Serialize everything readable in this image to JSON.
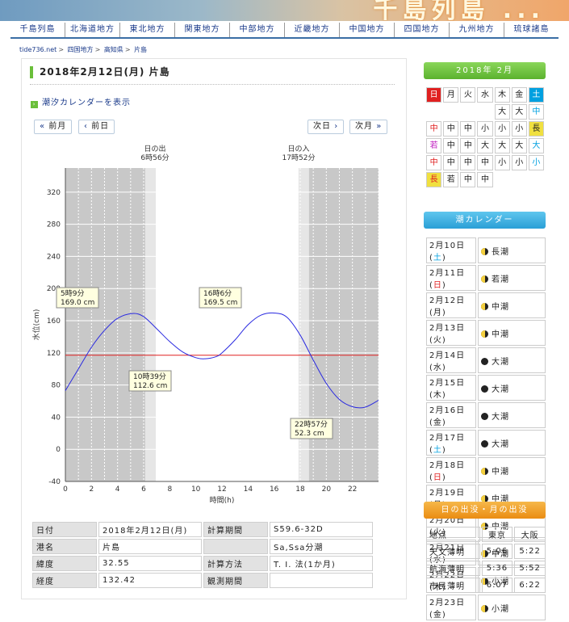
{
  "banner": {
    "title": "千島列島 ..."
  },
  "nav": [
    "千島列島",
    "北海道地方",
    "東北地方",
    "関東地方",
    "中部地方",
    "近畿地方",
    "中国地方",
    "四国地方",
    "九州地方",
    "琉球諸島"
  ],
  "breadcrumb": [
    "tide736.net",
    "四国地方",
    "高知県",
    "片島"
  ],
  "page_title": "2018年2月12日(月) 片島",
  "calendar_link": "潮汐カレンダーを表示",
  "buttons": {
    "prev_month": "前月",
    "prev_day": "前日",
    "next_day": "次日",
    "next_month": "次月"
  },
  "sun": {
    "rise_label": "日の出",
    "rise_time": "6時56分",
    "set_label": "日の入",
    "set_time": "17時52分"
  },
  "chart_data": {
    "type": "line",
    "xlabel": "時間(h)",
    "ylabel": "水位(cm)",
    "xlim": [
      0,
      24
    ],
    "ylim": [
      -40,
      350
    ],
    "xticks": [
      0,
      2,
      4,
      6,
      8,
      10,
      12,
      14,
      16,
      18,
      20,
      22
    ],
    "yticks": [
      -40,
      0,
      40,
      80,
      120,
      160,
      200,
      240,
      280,
      320
    ],
    "reference_level": 117,
    "series": [
      {
        "x": [
          0,
          1,
          2,
          3,
          4,
          5.15,
          6,
          7,
          8,
          9,
          10,
          10.65,
          11.5,
          12,
          13,
          14,
          15,
          16.1,
          17,
          18,
          19,
          20,
          21,
          22,
          22.95,
          24
        ],
        "y": [
          73,
          100,
          127,
          148,
          163,
          169,
          165,
          150,
          134,
          121,
          114,
          112.6,
          115,
          120,
          136,
          155,
          167,
          169.5,
          164,
          142,
          111,
          82,
          62,
          53,
          52.3,
          61
        ]
      }
    ],
    "annotations": [
      {
        "time": "5時9分",
        "level": "169.0 cm"
      },
      {
        "time": "10時39分",
        "level": "112.6 cm"
      },
      {
        "time": "16時6分",
        "level": "169.5 cm"
      },
      {
        "time": "22時57分",
        "level": "52.3 cm"
      }
    ]
  },
  "info": [
    [
      "日付",
      "2018年2月12日(月)",
      "計算期間",
      "S59.6-32D"
    ],
    [
      "港名",
      "片島",
      "",
      "Sa,Ssa分潮"
    ],
    [
      "緯度",
      "32.55",
      "計算方法",
      "T. I. 法(1か月)"
    ],
    [
      "経度",
      "132.42",
      "観測期間",
      ""
    ]
  ],
  "sidebar": {
    "month_title": "2018年 2月",
    "weekdays": [
      "日",
      "月",
      "火",
      "水",
      "木",
      "金",
      "土"
    ],
    "cal_rows": [
      [
        "",
        "",
        "",
        "",
        "大",
        "大",
        "中"
      ],
      [
        "中",
        "中",
        "中",
        "小",
        "小",
        "小",
        "長"
      ],
      [
        "若",
        "中",
        "中",
        "大",
        "大",
        "大",
        "大"
      ],
      [
        "中",
        "中",
        "中",
        "中",
        "小",
        "小",
        "小"
      ],
      [
        "長",
        "若",
        "中",
        "中",
        "",
        "",
        ""
      ]
    ],
    "tide_title": "潮カレンダー",
    "tide_days": [
      [
        "2月10日(土)",
        "長潮"
      ],
      [
        "2月11日(日)",
        "若潮"
      ],
      [
        "2月12日(月)",
        "中潮"
      ],
      [
        "2月13日(火)",
        "中潮"
      ],
      [
        "2月14日(水)",
        "大潮"
      ],
      [
        "2月15日(木)",
        "大潮"
      ],
      [
        "2月16日(金)",
        "大潮"
      ],
      [
        "2月17日(土)",
        "大潮"
      ],
      [
        "2月18日(日)",
        "中潮"
      ],
      [
        "2月19日(月)",
        "中潮"
      ],
      [
        "2月20日(火)",
        "中潮"
      ],
      [
        "2月21日(水)",
        "中潮"
      ],
      [
        "2月22日(木)",
        "小潮"
      ],
      [
        "2月23日(金)",
        "小潮"
      ]
    ],
    "sun_title": "日の出没・月の出没",
    "sun_header": [
      "地点",
      "東京",
      "大阪"
    ],
    "sun_rows": [
      [
        "天文薄明",
        "5:06",
        "5:22"
      ],
      [
        "航海薄明",
        "5:36",
        "5:52"
      ],
      [
        "市民薄明",
        "6:07",
        "6:22"
      ]
    ]
  },
  "colors": {
    "sat": "#00a0e0",
    "sun": "#e02020",
    "accent": "#6abf3a",
    "orange": "#f0a020",
    "blue": "#2ab0e0"
  }
}
